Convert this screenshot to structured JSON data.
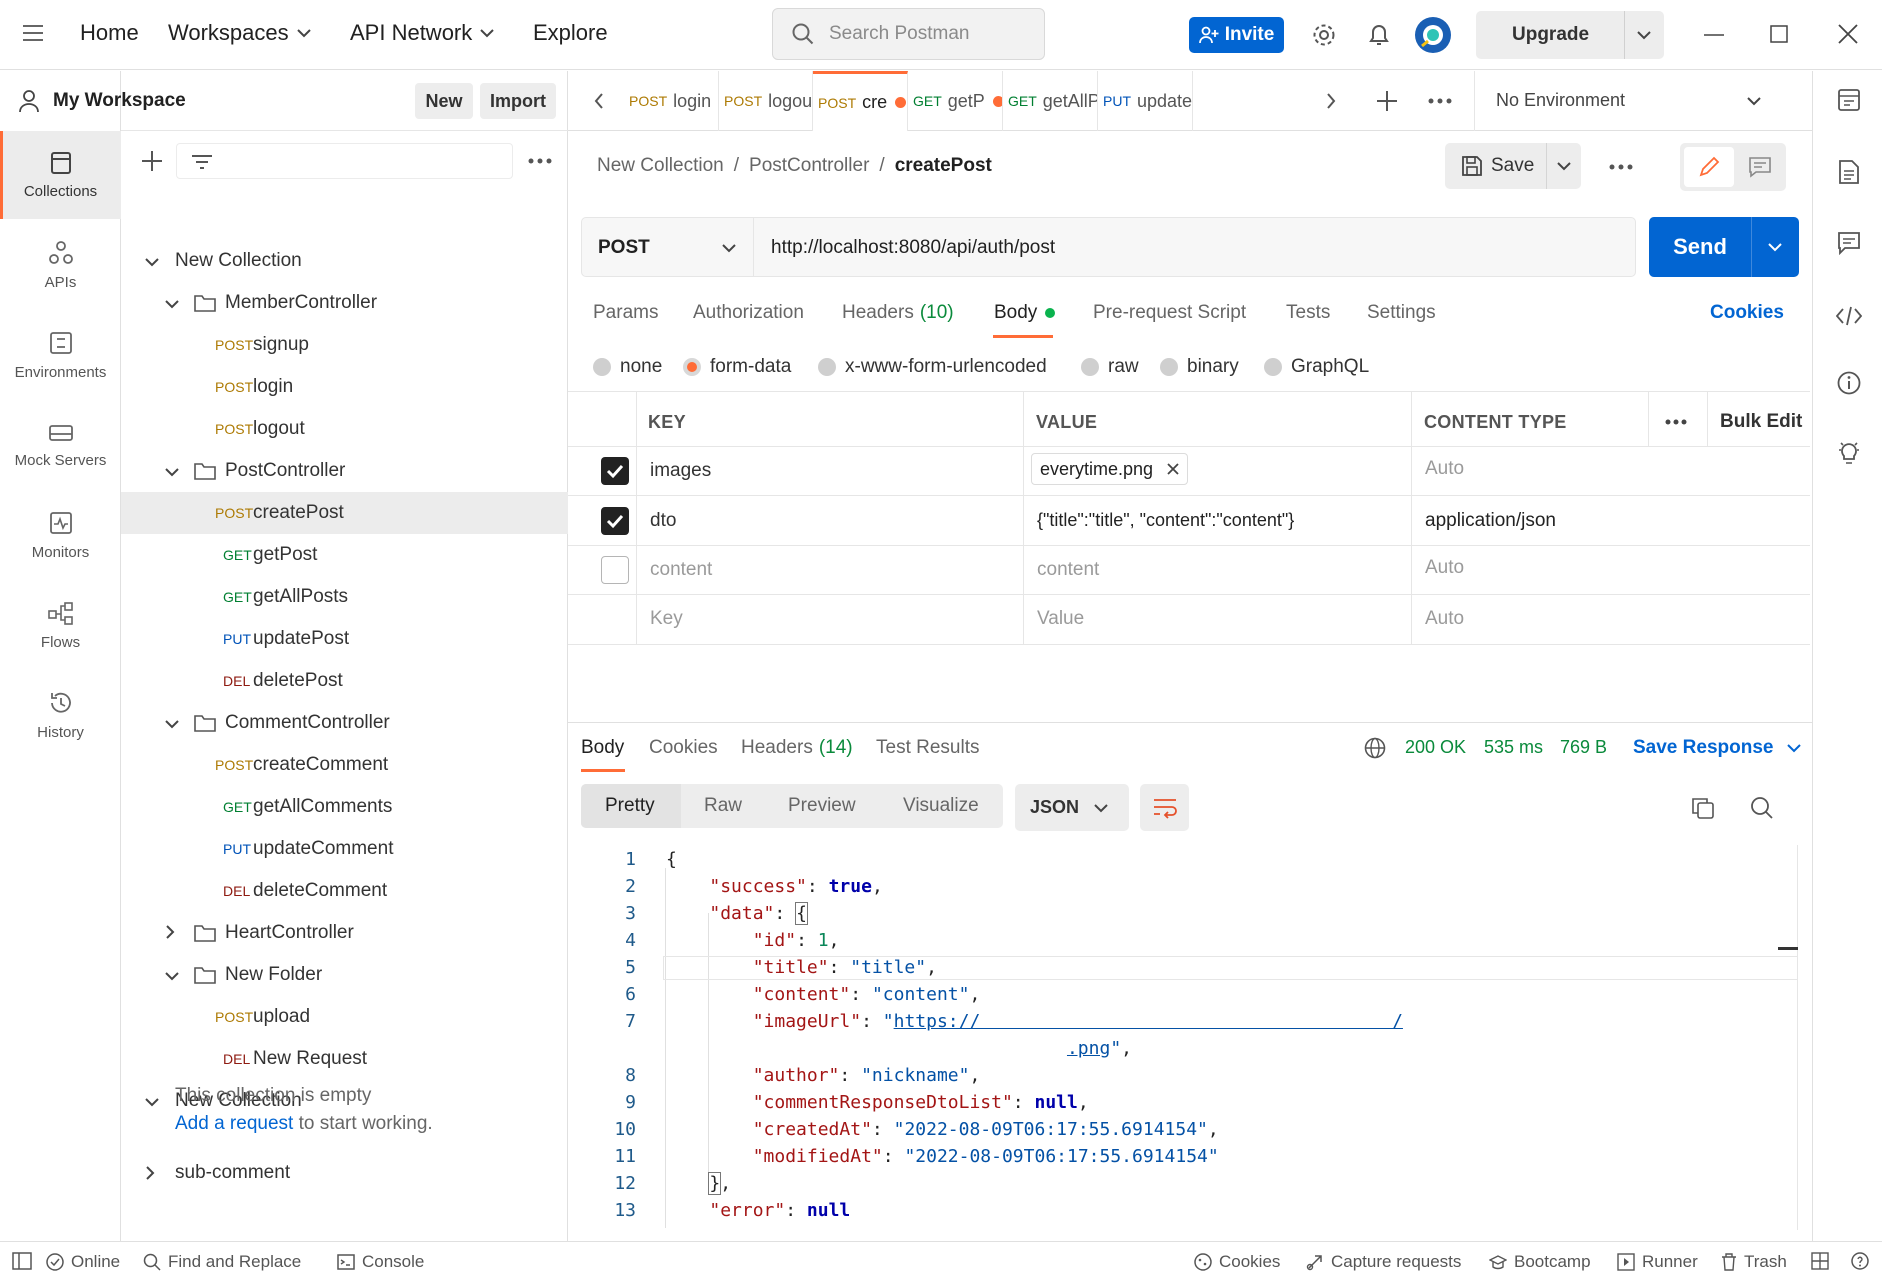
{
  "topbar": {
    "nav": [
      "Home",
      "Workspaces",
      "API Network",
      "Explore"
    ],
    "search_placeholder": "Search Postman",
    "invite_label": "Invite",
    "upgrade_label": "Upgrade"
  },
  "workspace": {
    "title": "My Workspace",
    "new_label": "New",
    "import_label": "Import"
  },
  "rail": [
    "Collections",
    "APIs",
    "Environments",
    "Mock Servers",
    "Monitors",
    "Flows",
    "History"
  ],
  "tree": [
    {
      "type": "collection",
      "label": "New Collection"
    },
    {
      "type": "folder",
      "label": "MemberController"
    },
    {
      "type": "request",
      "method": "POST",
      "label": "signup"
    },
    {
      "type": "request",
      "method": "POST",
      "label": "login"
    },
    {
      "type": "request",
      "method": "POST",
      "label": "logout"
    },
    {
      "type": "folder",
      "label": "PostController"
    },
    {
      "type": "request",
      "method": "POST",
      "label": "createPost"
    },
    {
      "type": "request",
      "method": "GET",
      "label": "getPost"
    },
    {
      "type": "request",
      "method": "GET",
      "label": "getAllPosts"
    },
    {
      "type": "request",
      "method": "PUT",
      "label": "updatePost"
    },
    {
      "type": "request",
      "method": "DEL",
      "label": "deletePost"
    },
    {
      "type": "folder",
      "label": "CommentController"
    },
    {
      "type": "request",
      "method": "POST",
      "label": "createComment"
    },
    {
      "type": "request",
      "method": "GET",
      "label": "getAllComments"
    },
    {
      "type": "request",
      "method": "PUT",
      "label": "updateComment"
    },
    {
      "type": "request",
      "method": "DEL",
      "label": "deleteComment"
    },
    {
      "type": "folder",
      "label": "HeartController"
    },
    {
      "type": "folder",
      "label": "New Folder"
    },
    {
      "type": "request",
      "method": "POST",
      "label": "upload"
    },
    {
      "type": "request",
      "method": "DEL",
      "label": "New Request"
    },
    {
      "type": "collection",
      "label": "New Collection"
    }
  ],
  "empty_collection": {
    "text1": "This collection is empty",
    "link": "Add a request",
    "text2": " to start working."
  },
  "last_collection": "sub-comment",
  "tabs": [
    {
      "method": "POST",
      "label": "login"
    },
    {
      "method": "POST",
      "label": "logou"
    },
    {
      "method": "POST",
      "label": "cre"
    },
    {
      "method": "GET",
      "label": "getP"
    },
    {
      "method": "GET",
      "label": "getAllP"
    },
    {
      "method": "PUT",
      "label": "update"
    }
  ],
  "environment": "No Environment",
  "breadcrumb": {
    "a": "New Collection",
    "b": "PostController",
    "c": "createPost",
    "sep": "/"
  },
  "save_label": "Save",
  "request": {
    "method": "POST",
    "url": "http://localhost:8080/api/auth/post",
    "send_label": "Send"
  },
  "req_tabs": {
    "params": "Params",
    "authorization": "Authorization",
    "headers": "Headers",
    "headers_count": "(10)",
    "body": "Body",
    "prerequest": "Pre-request Script",
    "tests": "Tests",
    "settings": "Settings",
    "cookies": "Cookies"
  },
  "body_modes": [
    "none",
    "form-data",
    "x-www-form-urlencoded",
    "raw",
    "binary",
    "GraphQL"
  ],
  "form_table": {
    "headers": {
      "key": "KEY",
      "value": "VALUE",
      "type": "CONTENT TYPE",
      "bulk": "Bulk Edit"
    },
    "rows": [
      {
        "key": "images",
        "value": "everytime.png",
        "type": "Auto"
      },
      {
        "key": "dto",
        "value": "{\"title\":\"title\", \"content\":\"content\"}",
        "type": "application/json"
      },
      {
        "key": "content",
        "value": "content",
        "type": "Auto"
      },
      {
        "key": "Key",
        "value": "Value",
        "type": "Auto"
      }
    ]
  },
  "response": {
    "tabs": {
      "body": "Body",
      "cookies": "Cookies",
      "headers": "Headers",
      "headers_count": "(14)",
      "tests": "Test Results"
    },
    "status": "200 OK",
    "time": "535 ms",
    "size": "769 B",
    "save_label": "Save Response",
    "views": [
      "Pretty",
      "Raw",
      "Preview",
      "Visualize"
    ],
    "format": "JSON",
    "line_numbers": [
      "1",
      "2",
      "3",
      "4",
      "5",
      "6",
      "7",
      "8",
      "9",
      "10",
      "11",
      "12",
      "13"
    ]
  },
  "status_bar": {
    "online": "Online",
    "find": "Find and Replace",
    "console": "Console",
    "cookies": "Cookies",
    "capture": "Capture requests",
    "bootcamp": "Bootcamp",
    "runner": "Runner",
    "trash": "Trash"
  }
}
